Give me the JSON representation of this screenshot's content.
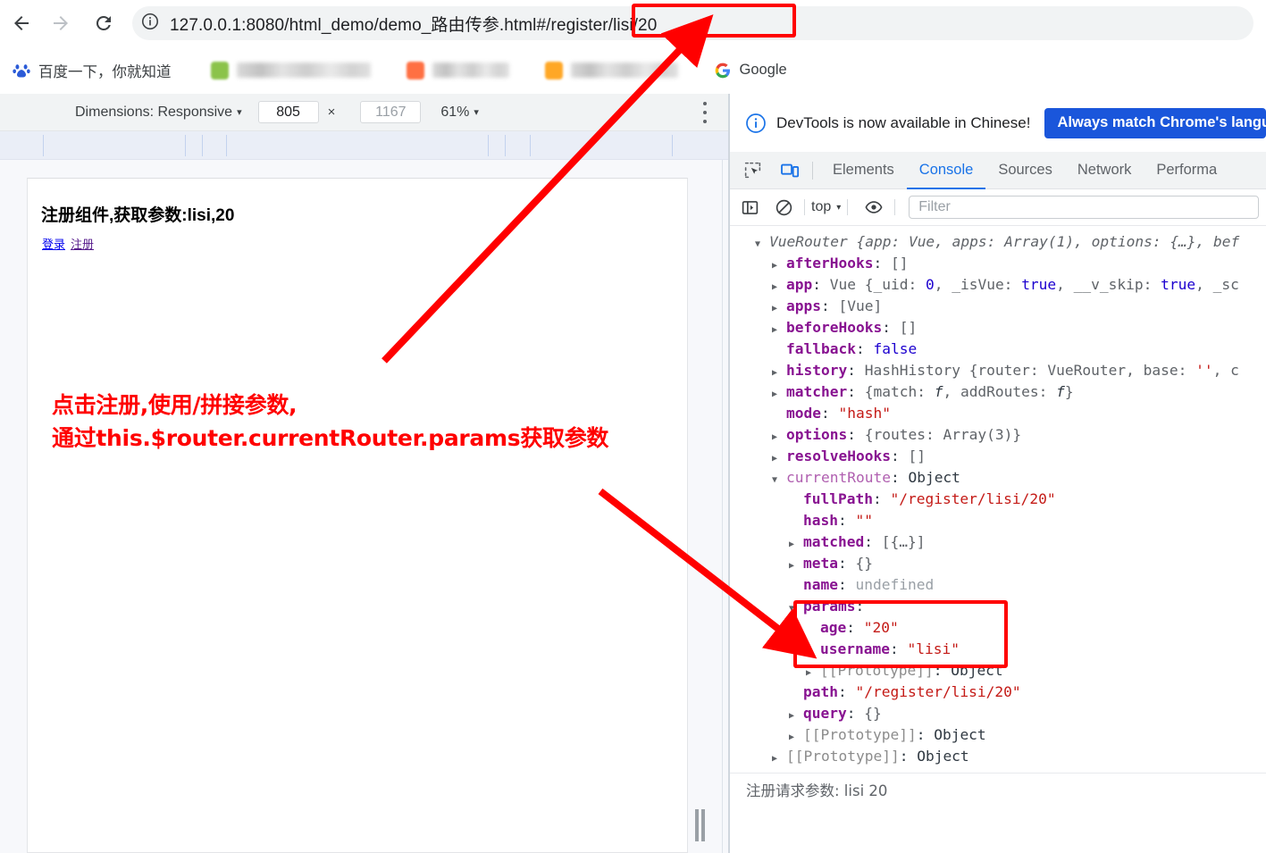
{
  "browser": {
    "nav": {
      "back_icon": "arrow-left-icon",
      "forward_icon": "arrow-right-icon",
      "reload_icon": "reload-icon"
    },
    "omnibox": {
      "info_icon": "page-info-icon",
      "url_main": "127.0.0.1:8080/html_demo/demo_路由传参.html#",
      "url_highlight": "/register/lisi/20"
    },
    "bookmarks": [
      {
        "label": "百度一下，你就知道",
        "icon": "baidu-icon",
        "redacted": false
      },
      {
        "label": "",
        "icon": "bookmark-icon",
        "redacted": true,
        "blur_width": "long"
      },
      {
        "label": "",
        "icon": "bookmark-icon",
        "redacted": true,
        "blur_width": "short"
      },
      {
        "label": "",
        "icon": "bookmark-icon",
        "redacted": true,
        "blur_width": "med"
      },
      {
        "label": "Google",
        "icon": "google-icon",
        "redacted": false
      }
    ]
  },
  "device_toolbar": {
    "dimensions_label": "Dimensions: Responsive",
    "dimensions_caret": "▾",
    "width_value": "805",
    "times": "×",
    "height_placeholder": "1167",
    "zoom_value": "61%",
    "zoom_caret": "▾",
    "kebab_icon": "more-options-icon"
  },
  "page": {
    "heading": "注册组件,获取参数:lisi,20",
    "links": [
      {
        "label": "登录",
        "state": "unvisited"
      },
      {
        "label": "注册",
        "state": "visited"
      }
    ],
    "resize_handle_icon": "viewport-resize-handle-icon"
  },
  "annotations": {
    "url_note": "点击注册,使用/拼接参数,\n通过this.$router.currentRouter.params获取参数",
    "url_note_line1": "点击注册,使用/拼接参数,",
    "url_note_line2": "通过this.$router.currentRouter.params获取参数",
    "accent_color": "#ff0000"
  },
  "devtools": {
    "banner": {
      "icon": "info-circle-icon",
      "text": "DevTools is now available in Chinese!",
      "button_label": "Always match Chrome's langua"
    },
    "toolbar_icons": [
      {
        "name": "inspect-element-icon",
        "active": false
      },
      {
        "name": "device-toolbar-icon",
        "active": true
      }
    ],
    "tabs": [
      {
        "label": "Elements",
        "active": false
      },
      {
        "label": "Console",
        "active": true
      },
      {
        "label": "Sources",
        "active": false
      },
      {
        "label": "Network",
        "active": false
      },
      {
        "label": "Performa",
        "active": false
      }
    ],
    "filterbar": {
      "sidebar_icon": "console-sidebar-icon",
      "clear_icon": "clear-console-icon",
      "context": "top",
      "context_caret": "▾",
      "eye_icon": "live-expression-icon",
      "filter_placeholder": "Filter"
    },
    "console_lines": [
      {
        "indent": 0,
        "tri": "d",
        "parts": [
          {
            "t": "VueRouter ",
            "c": "v-ital"
          },
          {
            "t": "{app: Vue, apps: Array(1), options: {…}, bef",
            "c": "v-ital"
          }
        ]
      },
      {
        "indent": 1,
        "tri": "r",
        "parts": [
          {
            "t": "afterHooks",
            "c": "k-name"
          },
          {
            "t": ": ",
            "c": "v-plain"
          },
          {
            "t": "[]",
            "c": "v-obj"
          }
        ]
      },
      {
        "indent": 1,
        "tri": "r",
        "parts": [
          {
            "t": "app",
            "c": "k-name"
          },
          {
            "t": ": ",
            "c": "v-plain"
          },
          {
            "t": "Vue ",
            "c": "v-obj"
          },
          {
            "t": "{_uid: ",
            "c": "v-obj"
          },
          {
            "t": "0",
            "c": "v-num"
          },
          {
            "t": ", _isVue: ",
            "c": "v-obj"
          },
          {
            "t": "true",
            "c": "v-bool"
          },
          {
            "t": ", __v_skip: ",
            "c": "v-obj"
          },
          {
            "t": "true",
            "c": "v-bool"
          },
          {
            "t": ", _sc",
            "c": "v-obj"
          }
        ]
      },
      {
        "indent": 1,
        "tri": "r",
        "parts": [
          {
            "t": "apps",
            "c": "k-name"
          },
          {
            "t": ": ",
            "c": "v-plain"
          },
          {
            "t": "[Vue]",
            "c": "v-obj"
          }
        ]
      },
      {
        "indent": 1,
        "tri": "r",
        "parts": [
          {
            "t": "beforeHooks",
            "c": "k-name"
          },
          {
            "t": ": ",
            "c": "v-plain"
          },
          {
            "t": "[]",
            "c": "v-obj"
          }
        ]
      },
      {
        "indent": 1,
        "tri": "none",
        "parts": [
          {
            "t": "fallback",
            "c": "k-name"
          },
          {
            "t": ": ",
            "c": "v-plain"
          },
          {
            "t": "false",
            "c": "v-bool"
          }
        ]
      },
      {
        "indent": 1,
        "tri": "r",
        "parts": [
          {
            "t": "history",
            "c": "k-name"
          },
          {
            "t": ": ",
            "c": "v-plain"
          },
          {
            "t": "HashHistory ",
            "c": "v-obj"
          },
          {
            "t": "{router: VueRouter, base: ",
            "c": "v-obj"
          },
          {
            "t": "''",
            "c": "v-str"
          },
          {
            "t": ", c",
            "c": "v-obj"
          }
        ]
      },
      {
        "indent": 1,
        "tri": "r",
        "parts": [
          {
            "t": "matcher",
            "c": "k-name"
          },
          {
            "t": ": ",
            "c": "v-plain"
          },
          {
            "t": "{match: ",
            "c": "v-obj"
          },
          {
            "t": "f",
            "c": "v-fn"
          },
          {
            "t": ", addRoutes: ",
            "c": "v-obj"
          },
          {
            "t": "f",
            "c": "v-fn"
          },
          {
            "t": "}",
            "c": "v-obj"
          }
        ]
      },
      {
        "indent": 1,
        "tri": "none",
        "parts": [
          {
            "t": "mode",
            "c": "k-name"
          },
          {
            "t": ": ",
            "c": "v-plain"
          },
          {
            "t": "\"hash\"",
            "c": "v-str"
          }
        ]
      },
      {
        "indent": 1,
        "tri": "r",
        "parts": [
          {
            "t": "options",
            "c": "k-name"
          },
          {
            "t": ": ",
            "c": "v-plain"
          },
          {
            "t": "{routes: Array(3)}",
            "c": "v-obj"
          }
        ]
      },
      {
        "indent": 1,
        "tri": "r",
        "parts": [
          {
            "t": "resolveHooks",
            "c": "k-name"
          },
          {
            "t": ": ",
            "c": "v-plain"
          },
          {
            "t": "[]",
            "c": "v-obj"
          }
        ]
      },
      {
        "indent": 1,
        "tri": "d",
        "parts": [
          {
            "t": "currentRoute",
            "c": "k-dim"
          },
          {
            "t": ": ",
            "c": "v-plain"
          },
          {
            "t": "Object",
            "c": "v-plain"
          }
        ]
      },
      {
        "indent": 2,
        "tri": "none",
        "parts": [
          {
            "t": "fullPath",
            "c": "k-name"
          },
          {
            "t": ": ",
            "c": "v-plain"
          },
          {
            "t": "\"/register/lisi/20\"",
            "c": "v-str"
          }
        ]
      },
      {
        "indent": 2,
        "tri": "none",
        "parts": [
          {
            "t": "hash",
            "c": "k-name"
          },
          {
            "t": ": ",
            "c": "v-plain"
          },
          {
            "t": "\"\"",
            "c": "v-str"
          }
        ]
      },
      {
        "indent": 2,
        "tri": "r",
        "parts": [
          {
            "t": "matched",
            "c": "k-name"
          },
          {
            "t": ": ",
            "c": "v-plain"
          },
          {
            "t": "[{…}]",
            "c": "v-obj"
          }
        ]
      },
      {
        "indent": 2,
        "tri": "r",
        "parts": [
          {
            "t": "meta",
            "c": "k-name"
          },
          {
            "t": ": ",
            "c": "v-plain"
          },
          {
            "t": "{}",
            "c": "v-obj"
          }
        ]
      },
      {
        "indent": 2,
        "tri": "none",
        "parts": [
          {
            "t": "name",
            "c": "k-name"
          },
          {
            "t": ": ",
            "c": "v-plain"
          },
          {
            "t": "undefined",
            "c": "v-undef"
          }
        ]
      },
      {
        "indent": 2,
        "tri": "d",
        "parts": [
          {
            "t": "params",
            "c": "k-name"
          },
          {
            "t": ":",
            "c": "v-plain"
          }
        ]
      },
      {
        "indent": 3,
        "tri": "none",
        "parts": [
          {
            "t": "age",
            "c": "k-name"
          },
          {
            "t": ": ",
            "c": "v-plain"
          },
          {
            "t": "\"20\"",
            "c": "v-str"
          }
        ]
      },
      {
        "indent": 3,
        "tri": "none",
        "parts": [
          {
            "t": "username",
            "c": "k-name"
          },
          {
            "t": ": ",
            "c": "v-plain"
          },
          {
            "t": "\"lisi\"",
            "c": "v-str"
          }
        ]
      },
      {
        "indent": 3,
        "tri": "r",
        "parts": [
          {
            "t": "[[Prototype]]",
            "c": "v-proto"
          },
          {
            "t": ": ",
            "c": "v-plain"
          },
          {
            "t": "Object",
            "c": "v-plain"
          }
        ]
      },
      {
        "indent": 2,
        "tri": "none",
        "parts": [
          {
            "t": "path",
            "c": "k-name"
          },
          {
            "t": ": ",
            "c": "v-plain"
          },
          {
            "t": "\"/register/lisi/20\"",
            "c": "v-str"
          }
        ]
      },
      {
        "indent": 2,
        "tri": "r",
        "parts": [
          {
            "t": "query",
            "c": "k-name"
          },
          {
            "t": ": ",
            "c": "v-plain"
          },
          {
            "t": "{}",
            "c": "v-obj"
          }
        ]
      },
      {
        "indent": 2,
        "tri": "r",
        "parts": [
          {
            "t": "[[Prototype]]",
            "c": "v-proto"
          },
          {
            "t": ": ",
            "c": "v-plain"
          },
          {
            "t": "Object",
            "c": "v-plain"
          }
        ]
      },
      {
        "indent": 1,
        "tri": "r",
        "parts": [
          {
            "t": "[[Prototype]]",
            "c": "v-proto"
          },
          {
            "t": ": ",
            "c": "v-plain"
          },
          {
            "t": "Object",
            "c": "v-plain"
          }
        ]
      }
    ],
    "console_message": "注册请求参数: lisi 20",
    "prompt_chevron": "›"
  }
}
